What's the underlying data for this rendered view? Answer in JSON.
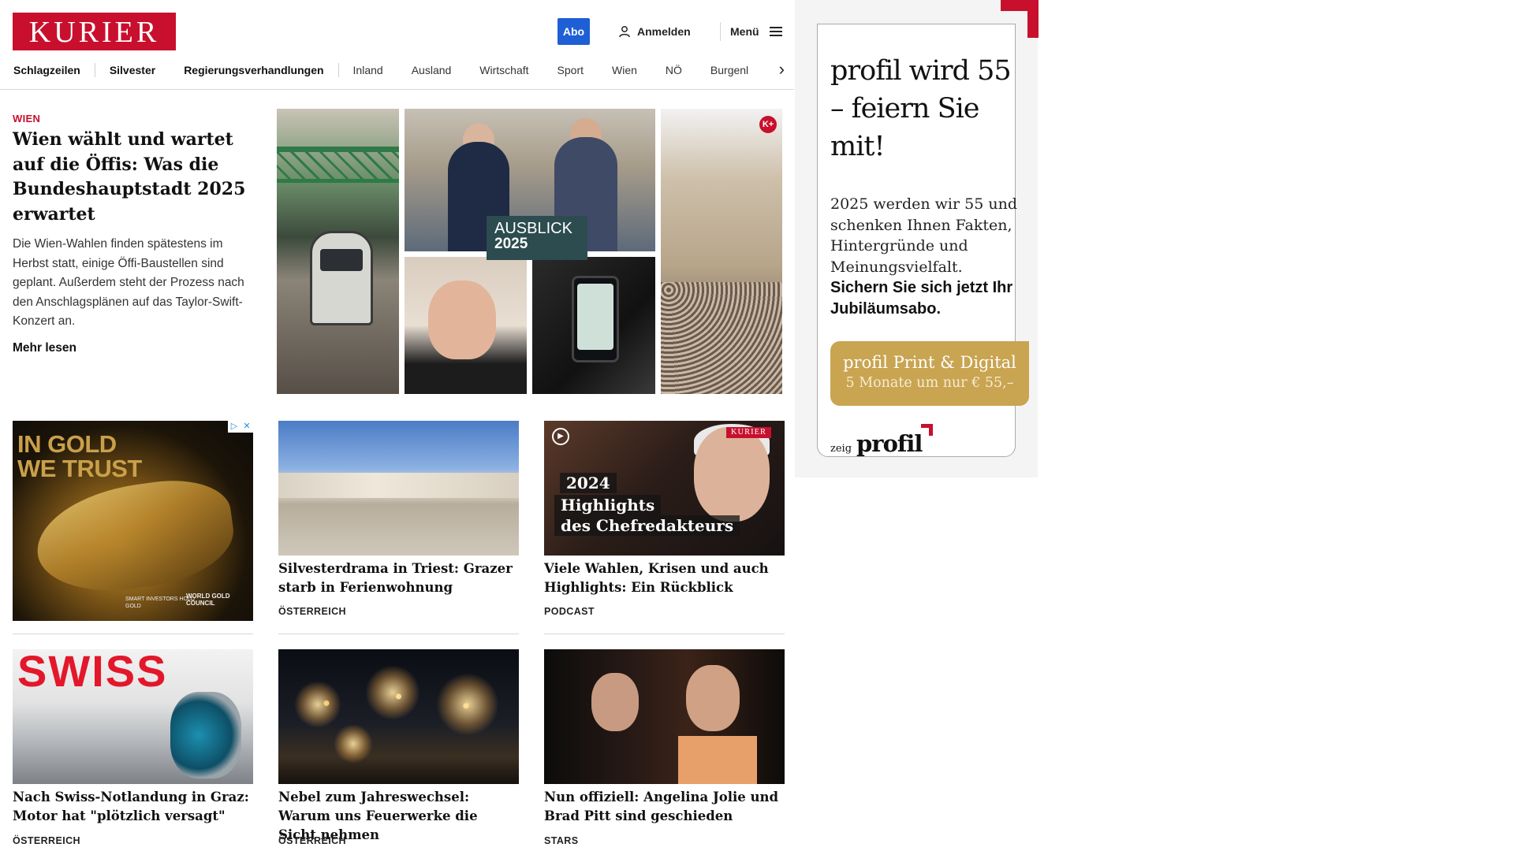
{
  "header": {
    "logo": "KURIER",
    "abo_label": "Abo",
    "login_label": "Anmelden",
    "menu_label": "Menü"
  },
  "nav": {
    "items": [
      {
        "label": "Schlagzeilen"
      },
      {
        "label": "Silvester"
      },
      {
        "label": "Regierungsverhandlungen"
      },
      {
        "label": "Inland"
      },
      {
        "label": "Ausland"
      },
      {
        "label": "Wirtschaft"
      },
      {
        "label": "Sport"
      },
      {
        "label": "Wien"
      },
      {
        "label": "NÖ"
      },
      {
        "label": "Burgenl"
      }
    ],
    "next_icon": "chevron-right-icon"
  },
  "lead": {
    "kicker": "WIEN",
    "title": "Wien wählt und wartet auf die Öffis: Was die Bundeshauptstadt 2025 erwartet",
    "teaser": "Die Wien-Wahlen finden spätestens im Herbst statt, einige Öffi-Baustellen sind geplant. Außerdem steht der Prozess nach den Anschlagsplänen auf das Taylor-Swift-Konzert an.",
    "more_label": "Mehr lesen",
    "image_label_line1": "AUSBLICK",
    "image_label_line2": "2025",
    "badge": "K+"
  },
  "ad_gold": {
    "headline_line1": "IN GOLD",
    "headline_line2": "WE TRUST",
    "slogan": "SMART INVESTORS HOLD GOLD",
    "brand": "WORLD GOLD COUNCIL",
    "choices_icons": [
      "ad-info-icon",
      "ad-close-icon"
    ]
  },
  "cards": [
    {
      "title": "Silvesterdrama in Triest: Grazer starb in Ferienwohnung",
      "kicker": "ÖSTERREICH"
    },
    {
      "title": "Viele Wahlen, Krisen und auch Highlights: Ein Rückblick",
      "kicker": "PODCAST",
      "overlay_year": "2024",
      "overlay_line1": "Highlights",
      "overlay_line2": "des Chefredakteurs",
      "overlay_brand": "KURIER"
    },
    {
      "title": "Nach Swiss-Notlandung in Graz: Motor hat \"plötzlich versagt\"",
      "kicker": "ÖSTERREICH",
      "image_text": "SWISS"
    },
    {
      "title": "Nebel zum Jahreswechsel: Warum uns Feuerwerke die Sicht nehmen",
      "kicker": "ÖSTERREICH"
    },
    {
      "title": "Nun offiziell: Angelina Jolie und Brad Pitt sind geschieden",
      "kicker": "STARS"
    }
  ],
  "ad_profil": {
    "headline": "profil wird 55 – feiern Sie mit!",
    "body": "2025 werden wir 55 und schenken Ihnen Fakten, Hintergründe und Meinungsvielfalt.",
    "cta_bold": "Sichern Sie sich jetzt Ihr Jubiläumsabo.",
    "button_line1": "profil Print & Digital",
    "button_line2": "5 Monate um nur € 55,–",
    "footer_small": "zeig",
    "footer_logo": "profil",
    "accent_color": "#c8102e",
    "button_color": "#c9a451"
  },
  "colors": {
    "brand_red": "#c8102e",
    "abo_blue": "#1f5fd6"
  }
}
